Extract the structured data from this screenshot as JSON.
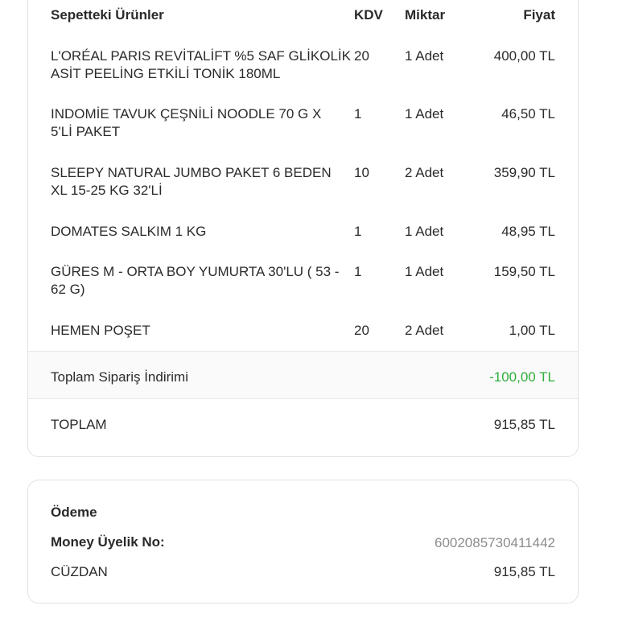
{
  "cart": {
    "headers": {
      "products": "Sepetteki Ürünler",
      "kdv": "KDV",
      "quantity": "Miktar",
      "price": "Fiyat"
    },
    "items": [
      {
        "name": "L'ORÉAL PARIS REVİTALİFT %5 SAF GLİKOLİK ASİT PEELİNG ETKİLİ TONİK 180ML",
        "kdv": "20",
        "quantity": "1 Adet",
        "price": "400,00 TL"
      },
      {
        "name": "INDOMİE TAVUK ÇEŞNİLİ NOODLE 70 G X 5'Lİ PAKET",
        "kdv": "1",
        "quantity": "1 Adet",
        "price": "46,50 TL"
      },
      {
        "name": "SLEEPY NATURAL JUMBO PAKET 6 BEDEN XL 15-25 KG 32'Lİ",
        "kdv": "10",
        "quantity": "2 Adet",
        "price": "359,90 TL"
      },
      {
        "name": "DOMATES SALKIM 1 KG",
        "kdv": "1",
        "quantity": "1 Adet",
        "price": "48,95 TL"
      },
      {
        "name": "GÜRES M - ORTA BOY YUMURTA 30'LU ( 53 - 62 G)",
        "kdv": "1",
        "quantity": "1 Adet",
        "price": "159,50 TL"
      },
      {
        "name": "HEMEN POŞET",
        "kdv": "20",
        "quantity": "2 Adet",
        "price": "1,00 TL"
      }
    ],
    "discount": {
      "label": "Toplam Sipariş İndirimi",
      "value": "-100,00 TL",
      "color": "#2fae3c"
    },
    "total": {
      "label": "TOPLAM",
      "value": "915,85 TL"
    }
  },
  "payment": {
    "title": "Ödeme",
    "member_label": "Money Üyelik No:",
    "member_value": "6002085730411442",
    "method_label": "CÜZDAN",
    "method_value": "915,85 TL"
  }
}
